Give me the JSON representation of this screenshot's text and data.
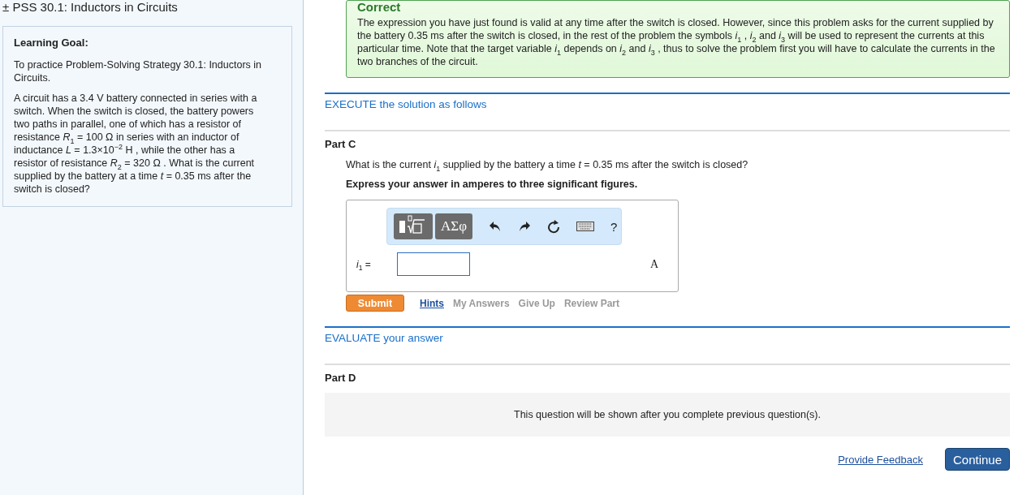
{
  "title": "± PSS 30.1: Inductors in Circuits",
  "sidebar": {
    "heading": "Learning Goal:",
    "paragraphs": [
      "To practice Problem-Solving Strategy 30.1: Inductors in Circuits.",
      "A circuit has a 3.4 V battery connected in series with a switch. When the switch is closed, the battery powers two paths in parallel, one of which has a resistor of resistance *R*$_{1}$ = 100 Ω in series with an inductor of inductance *L* = 1.3×10$^{−2}$ H , while the other has a resistor of resistance *R*$_{2}$ = 320 Ω . What is the current supplied by the battery at a time *t* = 0.35 ms after the switch is closed?"
    ]
  },
  "feedback": {
    "heading": "Correct",
    "text": "The expression you have just found is valid at any time after the switch is closed. However, since this problem asks for the current supplied by the battery 0.35 ms after the switch is closed, in the rest of the problem the symbols *i*$_{1}$ , *i*$_{2}$ and *i*$_{3}$ will be used to represent the currents at this particular time. Note that the target variable *i*$_{1}$ depends on *i*$_{2}$ and *i*$_{3}$ , thus to solve the problem first you will have to calculate the currents in the two branches of the circuit."
  },
  "sections": [
    {
      "kind": "step",
      "label": "EXECUTE the solution as follows"
    },
    {
      "kind": "part",
      "label": "Part C",
      "question": "What is the current *i*$_{1}$ supplied by the battery a time *t* = 0.35 ms after the switch is closed?",
      "instruction": "Express your answer in amperes to three significant figures.",
      "answer": {
        "toolbar": [
          {
            "kind": "templates"
          },
          {
            "kind": "symbols",
            "label": "ΑΣφ"
          },
          {
            "kind": "undo"
          },
          {
            "kind": "redo"
          },
          {
            "kind": "reset"
          },
          {
            "kind": "keyboard"
          },
          {
            "kind": "help",
            "label": "?"
          }
        ],
        "variable": "*i*$_{1}$ =",
        "unit": "A"
      },
      "submit": "Submit",
      "links": [
        {
          "label": "Hints",
          "disabled": false
        },
        {
          "label": "My Answers",
          "disabled": true
        },
        {
          "label": "Give Up",
          "disabled": true
        },
        {
          "label": "Review Part",
          "disabled": true
        }
      ]
    },
    {
      "kind": "step",
      "label": "EVALUATE your answer"
    },
    {
      "kind": "part",
      "label": "Part D",
      "locked_message": "This question will be shown after you complete previous question(s)."
    }
  ],
  "footer": {
    "feedback_link": "Provide Feedback",
    "continue": "Continue"
  }
}
